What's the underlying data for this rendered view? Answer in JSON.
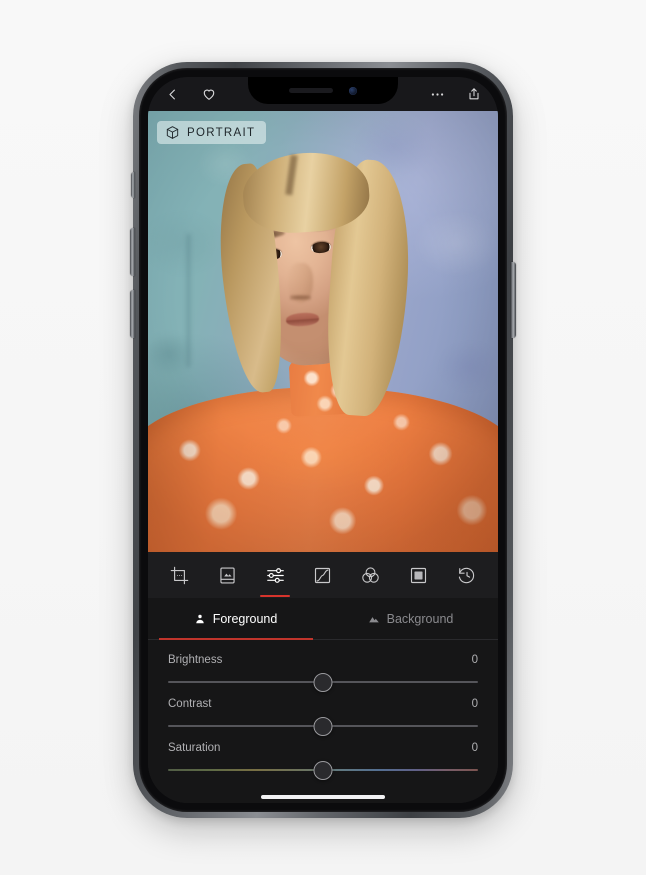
{
  "app": {
    "screen_name": "Photo Editor — Portrait Adjustments"
  },
  "topbar": {
    "back_label": "Back",
    "favorite_label": "Favorite",
    "more_label": "More options",
    "share_label": "Share",
    "icons": {
      "back": "chevron-left-icon",
      "favorite": "heart-icon",
      "more": "ellipsis-icon",
      "share": "share-icon"
    }
  },
  "photo": {
    "badge_label": "PORTRAIT",
    "badge_icon": "cube-icon",
    "subject_description": "Woman with blonde bob hair in orange paisley turtleneck against teal-blue wall"
  },
  "toolstrip": {
    "tools": [
      {
        "id": "crop",
        "label": "Crop",
        "icon": "crop-icon",
        "active": false
      },
      {
        "id": "presets",
        "label": "Presets",
        "icon": "photo-presets-icon",
        "active": false
      },
      {
        "id": "adjust",
        "label": "Adjust",
        "icon": "sliders-icon",
        "active": true
      },
      {
        "id": "curves",
        "label": "Curves",
        "icon": "curves-icon",
        "active": false
      },
      {
        "id": "color",
        "label": "Color Mixer",
        "icon": "color-wheels-icon",
        "active": false
      },
      {
        "id": "vignette",
        "label": "Vignette",
        "icon": "frame-icon",
        "active": false
      },
      {
        "id": "history",
        "label": "History",
        "icon": "history-icon",
        "active": false
      }
    ]
  },
  "tabs": [
    {
      "id": "foreground",
      "label": "Foreground",
      "icon": "person-icon",
      "active": true
    },
    {
      "id": "background",
      "label": "Background",
      "icon": "mountain-icon",
      "active": false
    }
  ],
  "sliders": [
    {
      "id": "brightness",
      "label": "Brightness",
      "value": "0",
      "position": 50,
      "rainbow": false
    },
    {
      "id": "contrast",
      "label": "Contrast",
      "value": "0",
      "position": 50,
      "rainbow": false
    },
    {
      "id": "saturation",
      "label": "Saturation",
      "value": "0",
      "position": 50,
      "rainbow": true
    }
  ],
  "colors": {
    "accent_red": "#d7342c",
    "tab_underline": "#c1352c",
    "panel_bg": "#161617",
    "toolstrip_bg": "#1d1d1f",
    "topbar_bg": "#18181b",
    "page_bg": "#f7f7f7",
    "badge_bg": "rgba(225,238,238,0.62)",
    "label_text": "#b0b0b3",
    "inactive_tab_text": "#8a8a8e"
  },
  "device": {
    "home_indicator": "home-indicator",
    "notch": "notch",
    "buttons": [
      "silent-switch",
      "volume-up-button",
      "volume-down-button",
      "power-button"
    ]
  }
}
